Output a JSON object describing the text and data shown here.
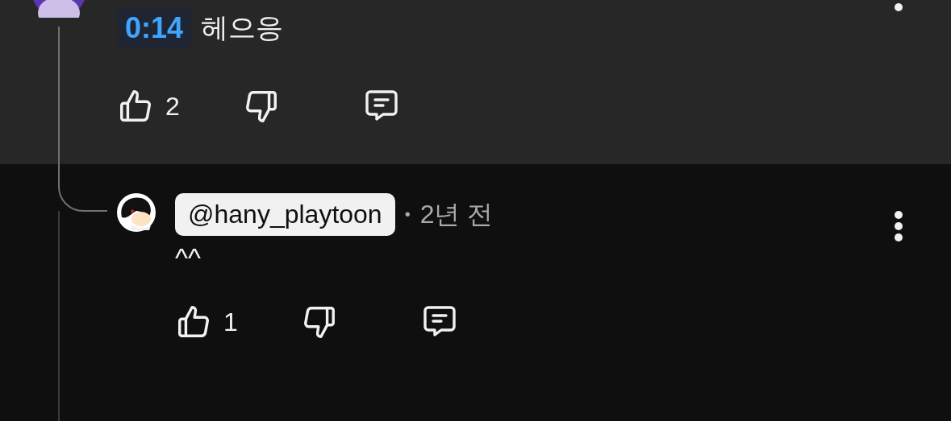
{
  "comments": [
    {
      "kind": "parent",
      "timestamp": "0:14",
      "text": "헤으응",
      "likes": "2"
    },
    {
      "kind": "reply",
      "handle": "@hany_playtoon",
      "separator": "•",
      "age": "2년 전",
      "text": "^^",
      "likes": "1"
    }
  ]
}
